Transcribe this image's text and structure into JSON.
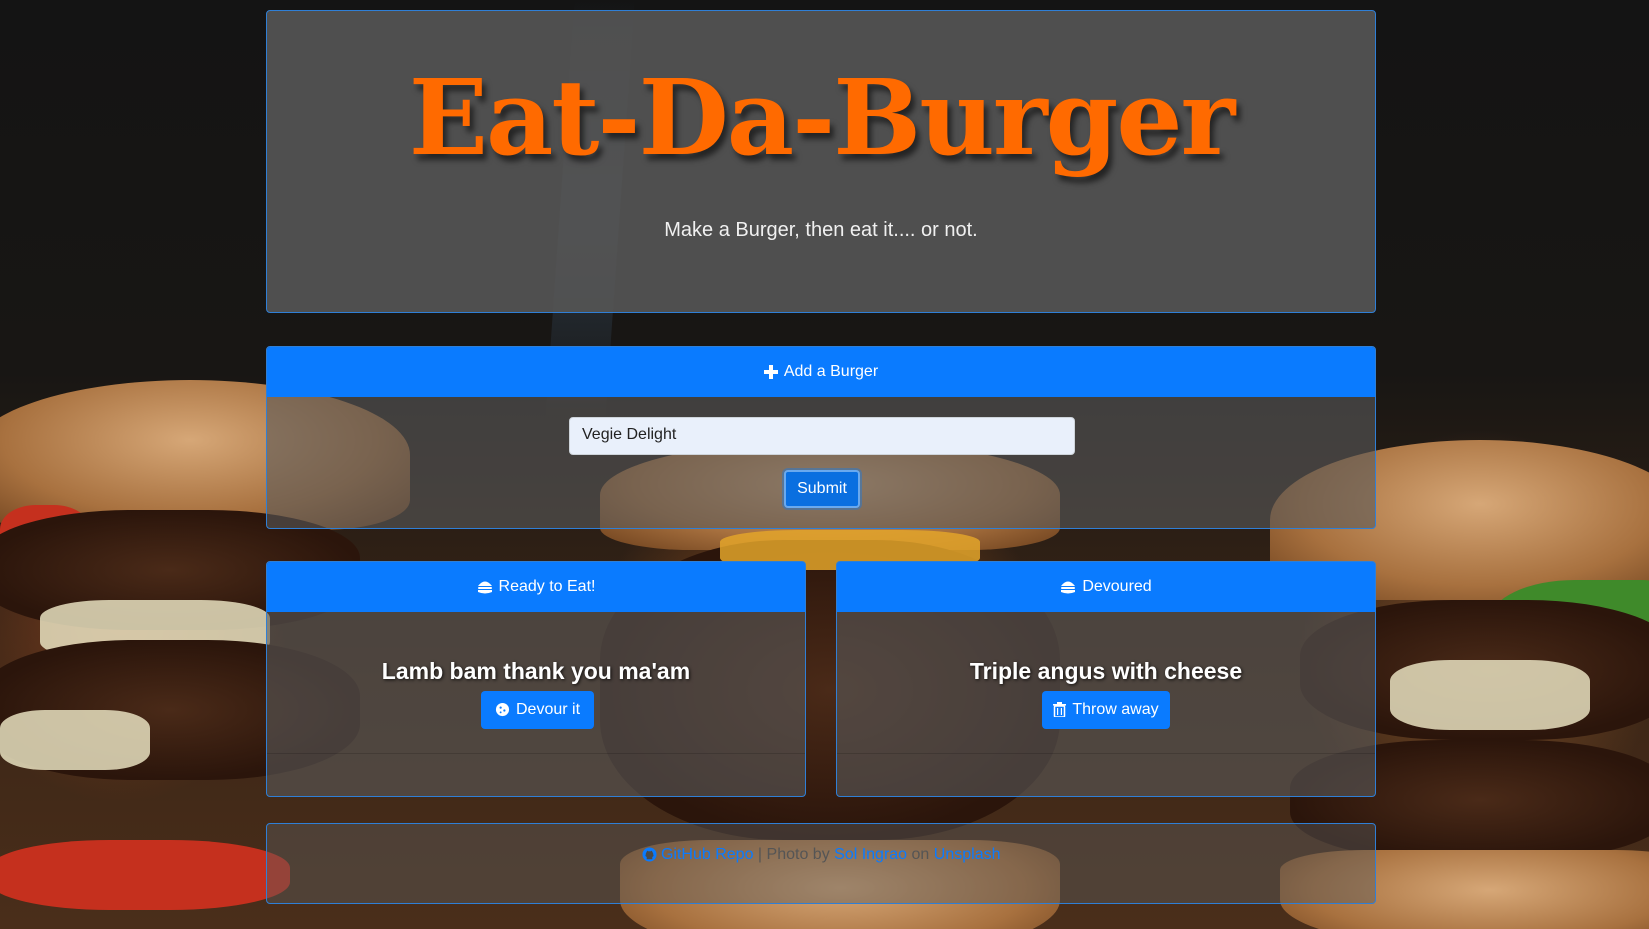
{
  "header": {
    "title": "Eat-Da-Burger",
    "tagline": "Make a Burger, then eat it.... or not."
  },
  "add_burger": {
    "header_label": "Add a Burger",
    "input_value": "Vegie Delight",
    "submit_label": "Submit"
  },
  "ready": {
    "header_label": "Ready to Eat!",
    "burgers": [
      {
        "name": "Lamb bam thank you ma'am",
        "button_label": "Devour it"
      }
    ]
  },
  "devoured": {
    "header_label": "Devoured",
    "burgers": [
      {
        "name": "Triple angus with cheese",
        "button_label": "Throw away"
      }
    ]
  },
  "footer": {
    "github_label": "GitHub Repo",
    "separator": "|",
    "photo_by": "Photo by",
    "photographer": "Sol Ingrao",
    "on": "on",
    "site": "Unsplash"
  },
  "colors": {
    "accent": "#0a7bff",
    "logo": "#ff6a00"
  }
}
